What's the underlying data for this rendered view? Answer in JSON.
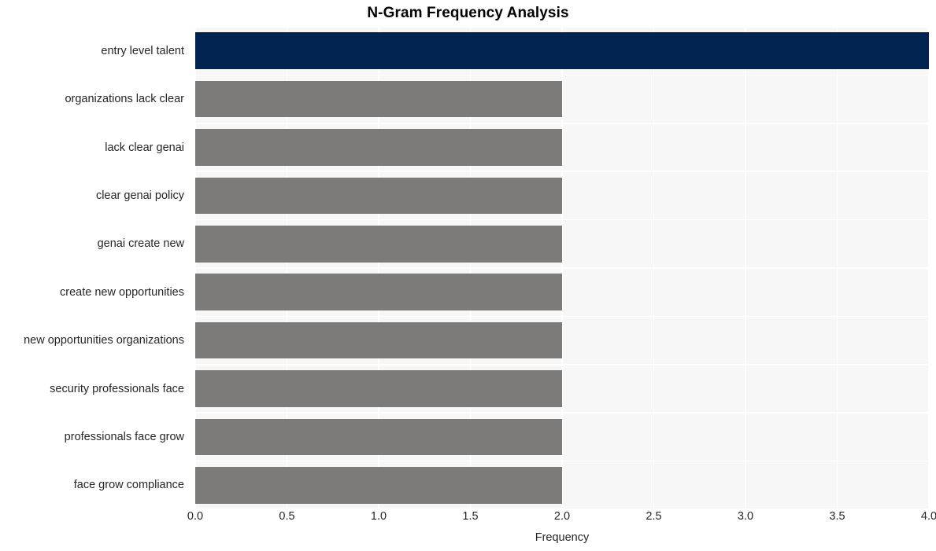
{
  "chart_data": {
    "type": "bar",
    "orientation": "horizontal",
    "title": "N-Gram Frequency Analysis",
    "xlabel": "Frequency",
    "ylabel": "",
    "categories": [
      "entry level talent",
      "organizations lack clear",
      "lack clear genai",
      "clear genai policy",
      "genai create new",
      "create new opportunities",
      "new opportunities organizations",
      "security professionals face",
      "professionals face grow",
      "face grow compliance"
    ],
    "values": [
      4,
      2,
      2,
      2,
      2,
      2,
      2,
      2,
      2,
      2
    ],
    "xlim": [
      0,
      4
    ],
    "xticks": [
      0.0,
      0.5,
      1.0,
      1.5,
      2.0,
      2.5,
      3.0,
      3.5,
      4.0
    ],
    "xtick_labels": [
      "0.0",
      "0.5",
      "1.0",
      "1.5",
      "2.0",
      "2.5",
      "3.0",
      "3.5",
      "4.0"
    ],
    "grid": true,
    "grid_color": "#ffffff",
    "legend": null,
    "bar_colors": [
      "#002350",
      "#7c7b79",
      "#7c7b79",
      "#7c7b79",
      "#7c7b79",
      "#7c7b79",
      "#7c7b79",
      "#7c7b79",
      "#7c7b79",
      "#7c7b79"
    ],
    "highlight_color": "#002350",
    "default_color": "#7c7b79",
    "plot_background": "#f7f7f7",
    "figure_background": "#ffffff"
  }
}
